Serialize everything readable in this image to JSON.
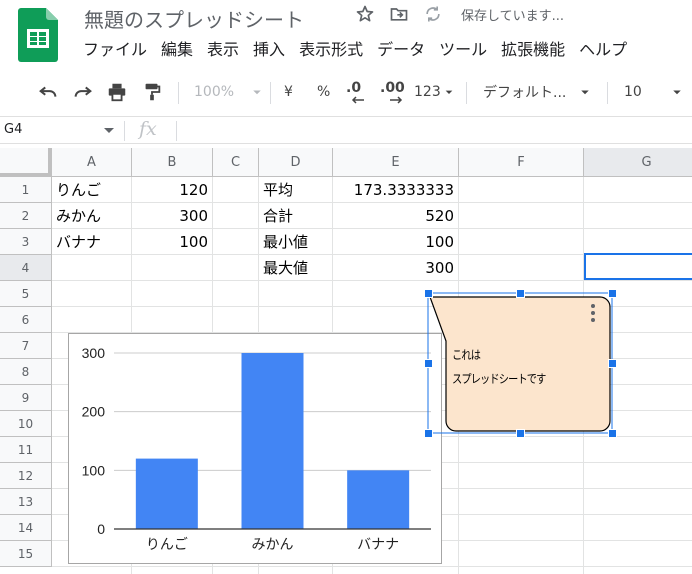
{
  "app": {
    "doc_title": "無題のスプレッドシート",
    "save_status": "保存しています..."
  },
  "menu": [
    "ファイル",
    "編集",
    "表示",
    "挿入",
    "表示形式",
    "データ",
    "ツール",
    "拡張機能",
    "ヘルプ"
  ],
  "toolbar": {
    "zoom": "100%",
    "currency": "¥",
    "percent": "%",
    "decimal_decrease": ".0",
    "decimal_increase": ".00",
    "number_format": "123",
    "font": "デフォルト...",
    "font_size": "10"
  },
  "formula_bar": {
    "cell_ref": "G4",
    "fx": "fx"
  },
  "columns": [
    "A",
    "B",
    "C",
    "D",
    "E",
    "F",
    "G"
  ],
  "rows": [
    "1",
    "2",
    "3",
    "4",
    "5",
    "6",
    "7",
    "8",
    "9",
    "10",
    "11",
    "12",
    "13",
    "14",
    "15"
  ],
  "cells": {
    "A1": "りんご",
    "B1": "120",
    "D1": "平均",
    "E1": "173.3333333",
    "A2": "みかん",
    "B2": "300",
    "D2": "合計",
    "E2": "520",
    "A3": "バナナ",
    "B3": "100",
    "D3": "最小値",
    "E3": "100",
    "D4": "最大値",
    "E4": "300"
  },
  "chart_data": {
    "type": "bar",
    "categories": [
      "りんご",
      "みかん",
      "バナナ"
    ],
    "values": [
      120,
      300,
      100
    ],
    "title": "",
    "xlabel": "",
    "ylabel": "",
    "ylim": [
      0,
      300
    ],
    "yticks": [
      "0",
      "100",
      "200",
      "300"
    ],
    "grid": true,
    "color": "#4285f4"
  },
  "callout": {
    "line1": "これは",
    "line2": "スプレッドシートです",
    "fill": "#fce5cd"
  },
  "colors": {
    "accent": "#1a73e8",
    "sheets_green": "#0f9d58"
  }
}
